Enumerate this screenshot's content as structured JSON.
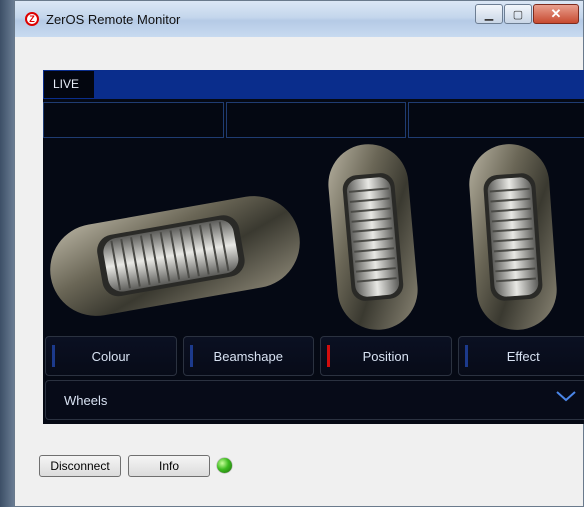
{
  "window": {
    "title": "ZerOS Remote Monitor",
    "icon": "zeros-app-icon",
    "controls": [
      "minimize",
      "maximize",
      "close"
    ]
  },
  "monitor": {
    "tab_label": "LIVE",
    "wheels": [
      "horizontal-encoder-wheel",
      "vertical-encoder-wheel",
      "vertical-encoder-wheel"
    ],
    "buttons": [
      {
        "label": "Colour",
        "indicator": "#1c3a8c"
      },
      {
        "label": "Beamshape",
        "indicator": "#1c3a8c"
      },
      {
        "label": "Position",
        "indicator": "#d20d0d"
      },
      {
        "label": "Effect",
        "indicator": "#1c3a8c"
      }
    ],
    "wheels_selector": "Wheels"
  },
  "footer": {
    "disconnect": "Disconnect",
    "info": "Info",
    "status_led_color": "#3dbb1f"
  }
}
